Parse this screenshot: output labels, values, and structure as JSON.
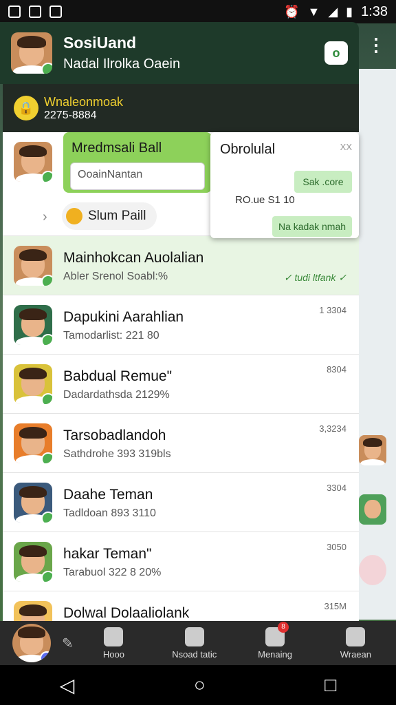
{
  "status_bar": {
    "time": "1:38"
  },
  "header": {
    "title": "SosiUand",
    "subtitle": "Nadal  Ilrolka Oaein"
  },
  "banner": {
    "title": "Wnaleonmoak",
    "subtitle": "2275-8884"
  },
  "group_card": {
    "title": "Mredmsali Ball",
    "input_placeholder": "OoainNantan",
    "pill_label": "Slum Paill"
  },
  "popup": {
    "title": "Obrolulal",
    "button1": "Sak .core",
    "price": "RO.ue  S1 10",
    "button2": "Na kadak nmah",
    "close": "XX"
  },
  "chats": [
    {
      "name": "Mainhokcan Auolalian",
      "preview": "Abler Srenol Soabl:%",
      "time": "",
      "status": "✓ tudi ltfank ✓",
      "active": true
    },
    {
      "name": "Dapukini Aarahlian",
      "preview": "Tamodarlist: 221 80",
      "time": "1 3304",
      "status": ""
    },
    {
      "name": "Babdual Remue\"",
      "preview": "Dadardathsda 2129%",
      "time": "8304",
      "status": ""
    },
    {
      "name": "Tarsobadlandoh",
      "preview": "Sathdrohe 393  319bls",
      "time": "3,3234",
      "status": ""
    },
    {
      "name": "Daahe Teman",
      "preview": "Tadldoan 893  3110",
      "time": "3304",
      "status": ""
    },
    {
      "name": "hakar Teman\"",
      "preview": "Tarabuol 322  8 20%",
      "time": "3050",
      "status": ""
    },
    {
      "name": "Dolwal Dolaaliolank",
      "preview": "",
      "time": "315M",
      "status": ""
    }
  ],
  "bottom_nav": {
    "items": [
      {
        "label": "Hooo",
        "icon": "folder-icon"
      },
      {
        "label": "Nsoad tatic",
        "icon": "people-icon"
      },
      {
        "label": "Menaing",
        "icon": "heart-icon",
        "badge": "8"
      },
      {
        "label": "Wraean",
        "icon": "clipboard-icon"
      }
    ]
  }
}
